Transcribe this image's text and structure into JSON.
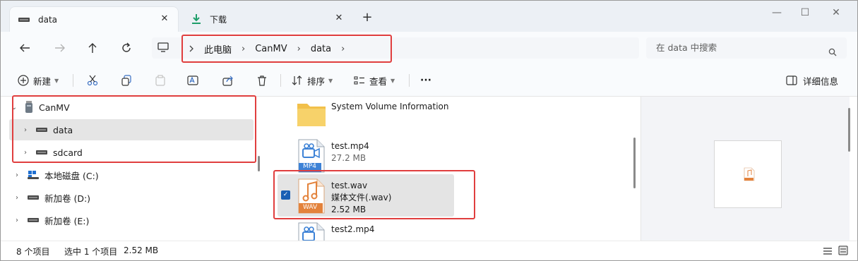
{
  "tabs": [
    {
      "label": "data",
      "icon": "drive-icon"
    },
    {
      "label": "下载",
      "icon": "download-icon"
    }
  ],
  "window_controls": {
    "minimize": "—",
    "maximize": "☐",
    "close": "✕"
  },
  "breadcrumb": [
    "此电脑",
    "CanMV",
    "data"
  ],
  "search": {
    "placeholder": "在 data 中搜索"
  },
  "toolbar": {
    "new_label": "新建",
    "sort_label": "排序",
    "view_label": "查看",
    "more_label": "···",
    "details_label": "详细信息"
  },
  "nav": {
    "items": [
      {
        "label": "CanMV",
        "icon": "usb-drive-icon",
        "expanded": true
      },
      {
        "label": "data",
        "icon": "drive-icon",
        "selected": true
      },
      {
        "label": "sdcard",
        "icon": "drive-icon"
      },
      {
        "label": "本地磁盘 (C:)",
        "icon": "windows-drive-icon"
      },
      {
        "label": "新加卷 (D:)",
        "icon": "drive-icon"
      },
      {
        "label": "新加卷 (E:)",
        "icon": "drive-icon"
      }
    ]
  },
  "files": [
    {
      "name": "System Volume Information",
      "type": "folder",
      "sub": "",
      "size": ""
    },
    {
      "name": "test.mp4",
      "type": "video",
      "badge": "MP4",
      "sub": "",
      "size": "27.2 MB"
    },
    {
      "name": "test.wav",
      "type": "audio",
      "badge": "WAV",
      "sub": "媒体文件(.wav)",
      "size": "2.52 MB",
      "selected": true
    },
    {
      "name": "test2.mp4",
      "type": "video",
      "badge": "MP4",
      "sub": "",
      "size": ""
    }
  ],
  "status": {
    "item_count": "8 个项目",
    "selection": "选中 1 个项目",
    "selection_size": "2.52 MB"
  },
  "colors": {
    "accent": "#1a5fb4",
    "highlight_border": "#e03e3e",
    "audio": "#e3823b",
    "video": "#3d82d6"
  }
}
